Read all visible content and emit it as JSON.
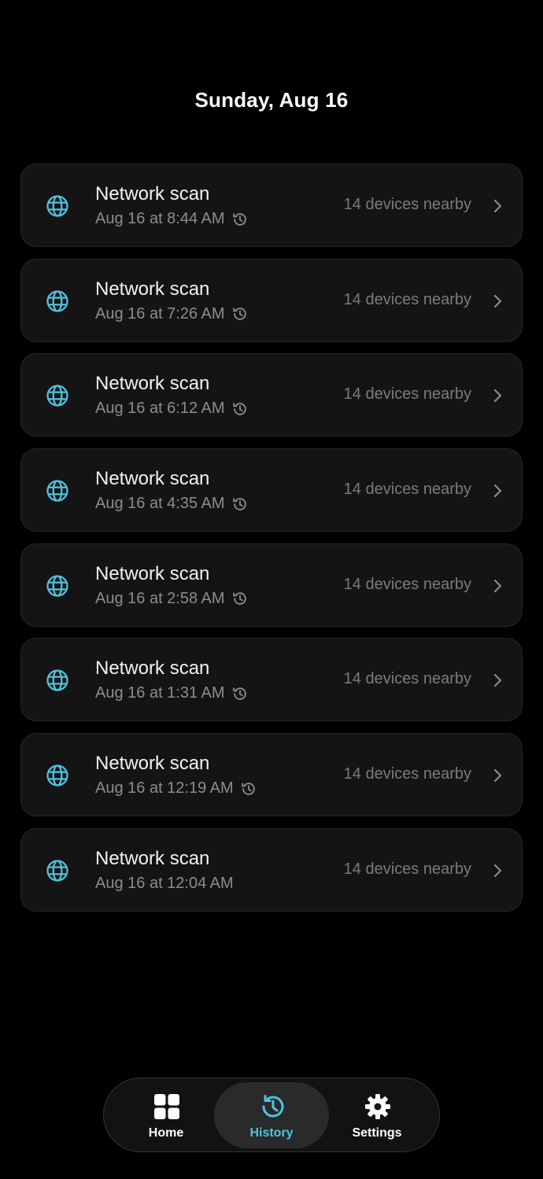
{
  "header": {
    "date": "Sunday, Aug 16"
  },
  "scans": [
    {
      "title": "Network scan",
      "time": "Aug 16 at 8:44 AM",
      "count": "14 devices nearby",
      "history_icon": true
    },
    {
      "title": "Network scan",
      "time": "Aug 16 at 7:26 AM",
      "count": "14 devices nearby",
      "history_icon": true
    },
    {
      "title": "Network scan",
      "time": "Aug 16 at 6:12 AM",
      "count": "14 devices nearby",
      "history_icon": true
    },
    {
      "title": "Network scan",
      "time": "Aug 16 at 4:35 AM",
      "count": "14 devices nearby",
      "history_icon": true
    },
    {
      "title": "Network scan",
      "time": "Aug 16 at 2:58 AM",
      "count": "14 devices nearby",
      "history_icon": true
    },
    {
      "title": "Network scan",
      "time": "Aug 16 at 1:31 AM",
      "count": "14 devices nearby",
      "history_icon": true
    },
    {
      "title": "Network scan",
      "time": "Aug 16 at 12:19 AM",
      "count": "14 devices nearby",
      "history_icon": true
    },
    {
      "title": "Network scan",
      "time": "Aug 16 at 12:04 AM",
      "count": "14 devices nearby",
      "history_icon": false
    }
  ],
  "tabbar": {
    "tabs": [
      {
        "label": "Home",
        "icon": "grid-icon",
        "active": false
      },
      {
        "label": "History",
        "icon": "history-icon",
        "active": true
      },
      {
        "label": "Settings",
        "icon": "gear-icon",
        "active": false
      }
    ]
  },
  "colors": {
    "background": "#000000",
    "card": "#141414",
    "accent": "#4fc3e0",
    "text_primary": "#f2f2f2",
    "text_secondary": "#8d8d8d"
  }
}
